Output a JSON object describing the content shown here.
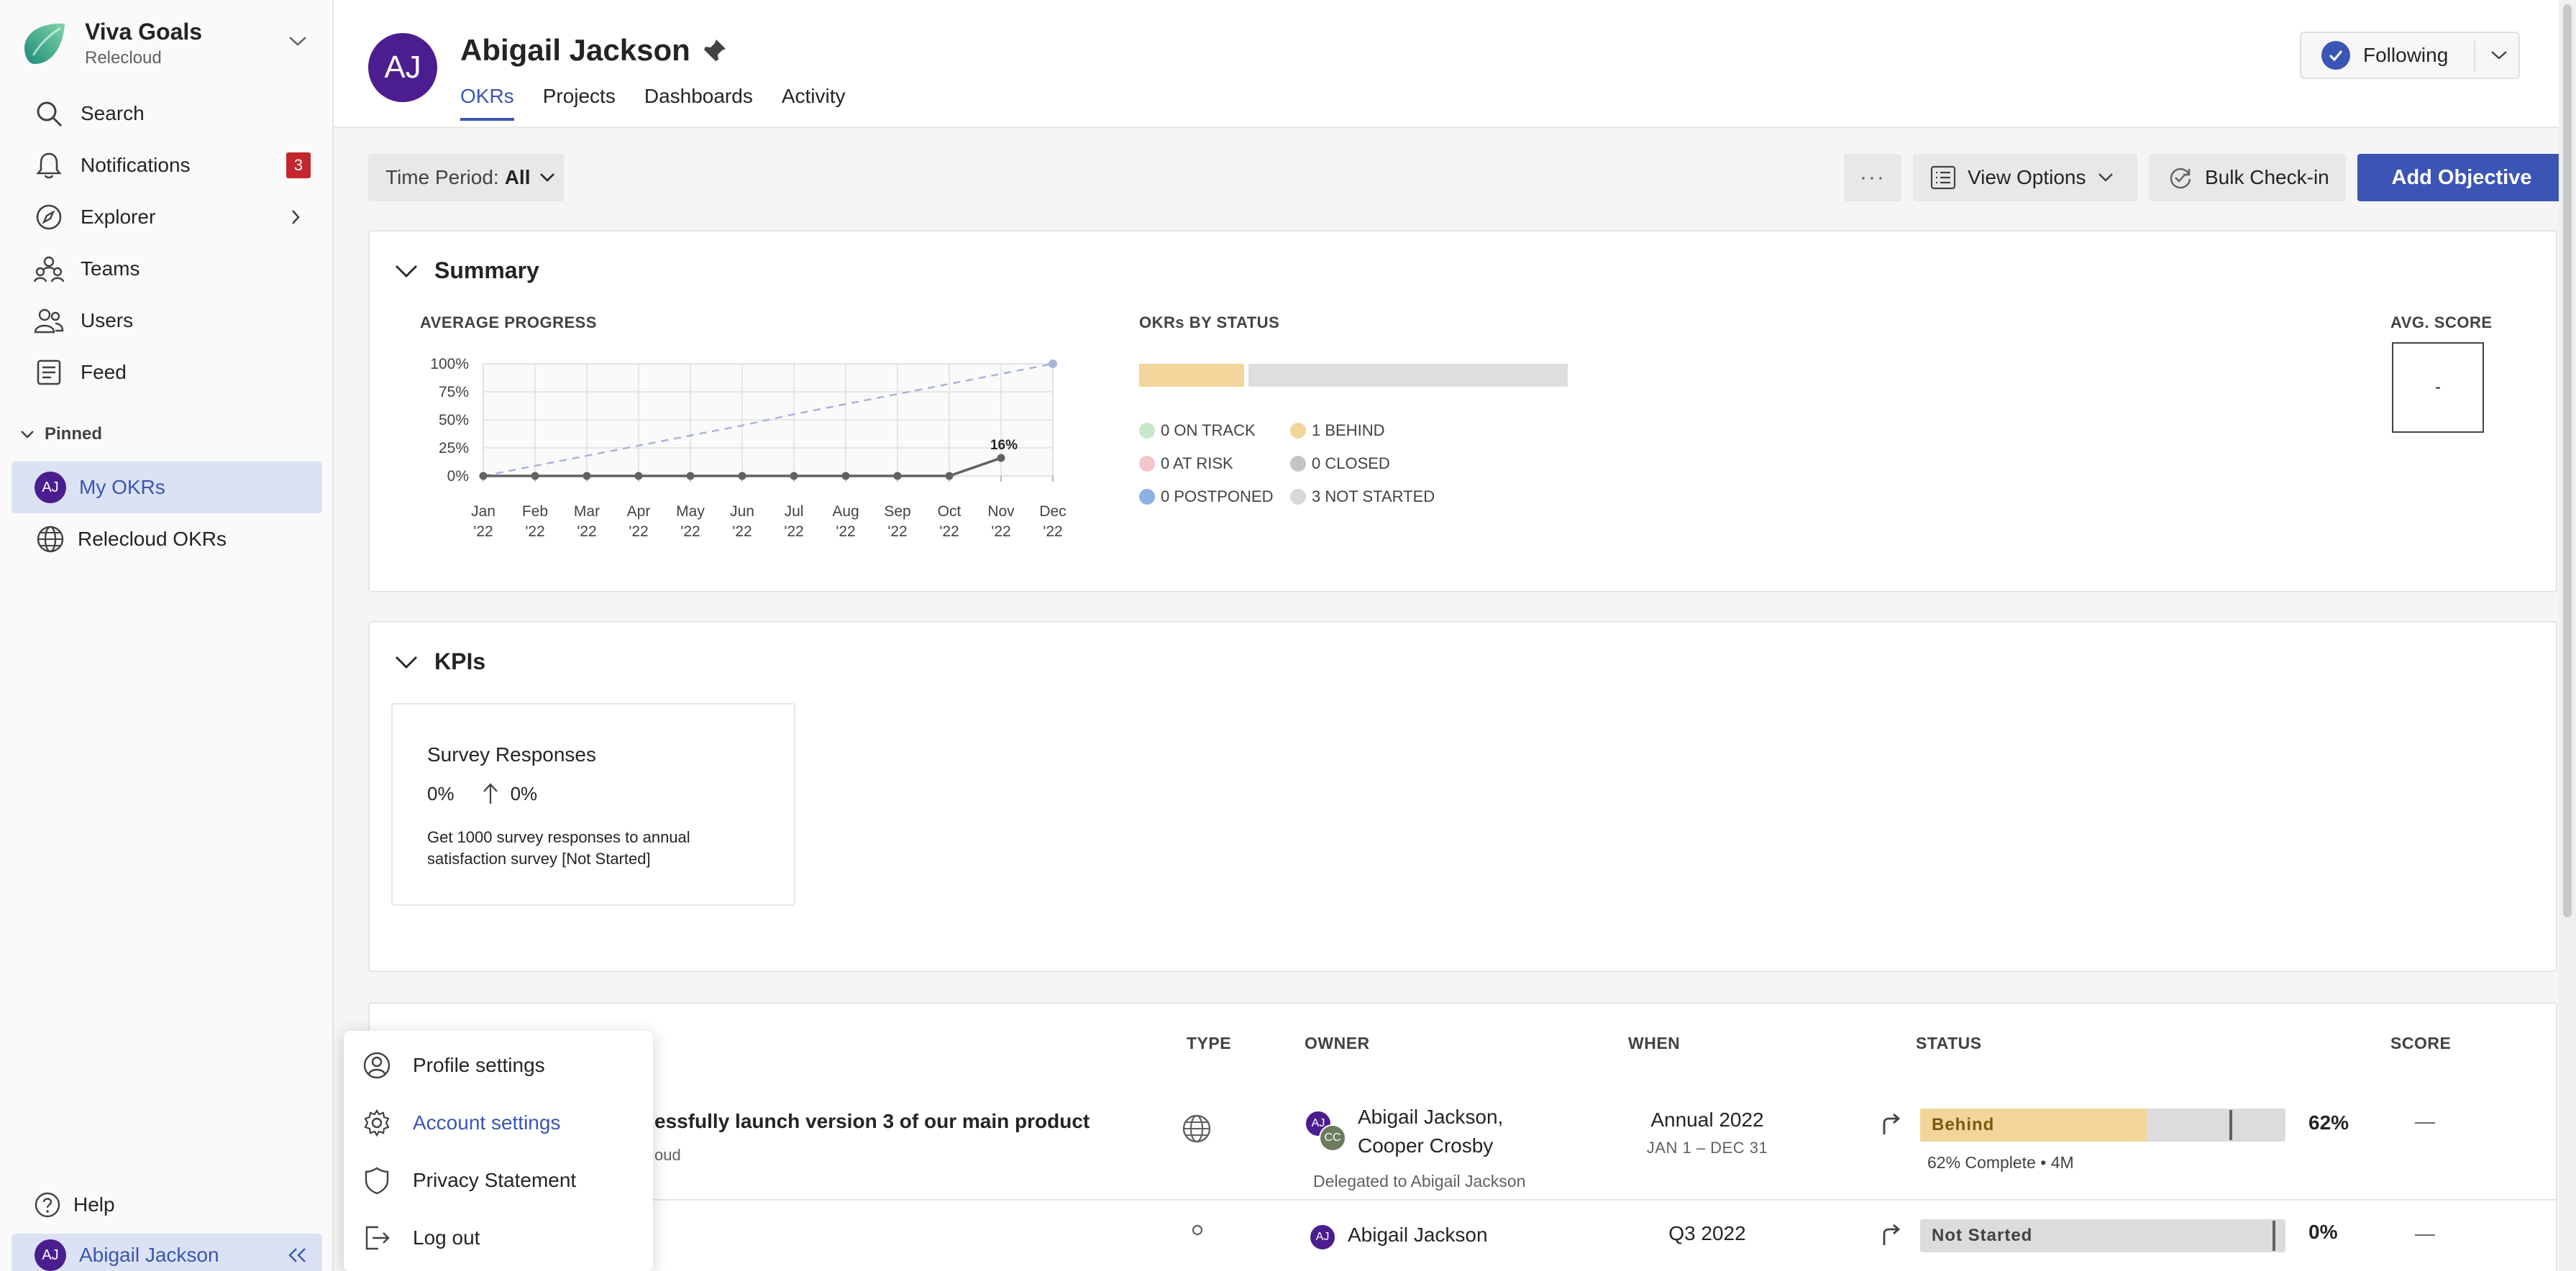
{
  "app": {
    "name": "Viva Goals",
    "org": "Relecloud"
  },
  "sidebar": {
    "items": [
      {
        "label": "Search",
        "icon": "search-icon"
      },
      {
        "label": "Notifications",
        "icon": "bell-icon",
        "badge": "3"
      },
      {
        "label": "Explorer",
        "icon": "compass-icon"
      },
      {
        "label": "Teams",
        "icon": "teams-icon"
      },
      {
        "label": "Users",
        "icon": "users-icon"
      },
      {
        "label": "Feed",
        "icon": "feed-icon"
      }
    ],
    "pinned_label": "Pinned",
    "pinned": [
      {
        "label": "My OKRs",
        "avatar": "AJ"
      },
      {
        "label": "Relecloud OKRs",
        "icon": "globe-icon"
      }
    ],
    "help": "Help",
    "me": {
      "label": "Abigail Jackson",
      "avatar": "AJ"
    }
  },
  "header": {
    "avatar": "AJ",
    "name": "Abigail Jackson",
    "tabs": [
      "OKRs",
      "Projects",
      "Dashboards",
      "Activity"
    ],
    "active_tab": "OKRs",
    "follow_label": "Following"
  },
  "toolbar": {
    "period_label": "Time Period:",
    "period_value": "All",
    "more": "···",
    "view_options": "View Options",
    "bulk_checkin": "Bulk Check-in",
    "add_objective": "Add Objective"
  },
  "summary": {
    "title": "Summary",
    "avg_progress_label": "AVERAGE PROGRESS",
    "status_label": "OKRs BY STATUS",
    "avg_score_label": "AVG. SCORE",
    "avg_score_value": "-",
    "status_counts": [
      {
        "label": "0 ON TRACK",
        "color": "#c7e8c7"
      },
      {
        "label": "1 BEHIND",
        "color": "#f2d59a"
      },
      {
        "label": "0 AT RISK",
        "color": "#f3c4c8"
      },
      {
        "label": "0 CLOSED",
        "color": "#c4c4c4"
      },
      {
        "label": "0 POSTPONED",
        "color": "#8fb0e4"
      },
      {
        "label": "3 NOT STARTED",
        "color": "#d8d8d8"
      }
    ]
  },
  "chart_data": {
    "type": "line",
    "title": "",
    "x": [
      "Jan '22",
      "Feb '22",
      "Mar '22",
      "Apr '22",
      "May '22",
      "Jun '22",
      "Jul '22",
      "Aug '22",
      "Sep '22",
      "Oct '22",
      "Nov '22",
      "Dec '22"
    ],
    "y_ticks": [
      "100%",
      "75%",
      "50%",
      "25%",
      "0%"
    ],
    "ylim": [
      0,
      100
    ],
    "series": [
      {
        "values": [
          0,
          0,
          0,
          0,
          0,
          0,
          0,
          0,
          0,
          0,
          16,
          null
        ],
        "style": "solid",
        "end_label": "16%"
      },
      {
        "values": [
          0,
          9,
          18,
          27,
          36,
          45,
          55,
          64,
          73,
          82,
          91,
          100
        ],
        "style": "dashed"
      }
    ],
    "grid": true
  },
  "status_bar": {
    "behind_fraction": 0.25,
    "not_started_fraction": 0.75
  },
  "kpis": {
    "title": "KPIs",
    "items": [
      {
        "name": "Survey Responses",
        "value": "0%",
        "change": "0%",
        "description": "Get 1000 survey responses to annual satisfaction survey [Not Started]"
      }
    ]
  },
  "table": {
    "columns": [
      "TYPE",
      "OWNER",
      "WHEN",
      "STATUS",
      "SCORE"
    ],
    "rows": [
      {
        "title": "essfully launch version 3 of our main product",
        "sub": "oud",
        "owners": "Abigail Jackson,",
        "owners2": "Cooper Crosby",
        "delegated": "Delegated to Abigail Jackson",
        "when": "Annual 2022",
        "when_sub": "JAN 1 – DEC 31",
        "status": "Behind",
        "progress": 62,
        "progress_text": "62%",
        "complete_note": "62% Complete • 4M",
        "score": "—"
      },
      {
        "owners": "Abigail Jackson",
        "when": "Q3 2022",
        "status": "Not Started",
        "progress": 0,
        "progress_text": "0%",
        "score": "—"
      }
    ]
  },
  "menu": {
    "items": [
      "Profile settings",
      "Account settings",
      "Privacy Statement",
      "Log out"
    ]
  }
}
